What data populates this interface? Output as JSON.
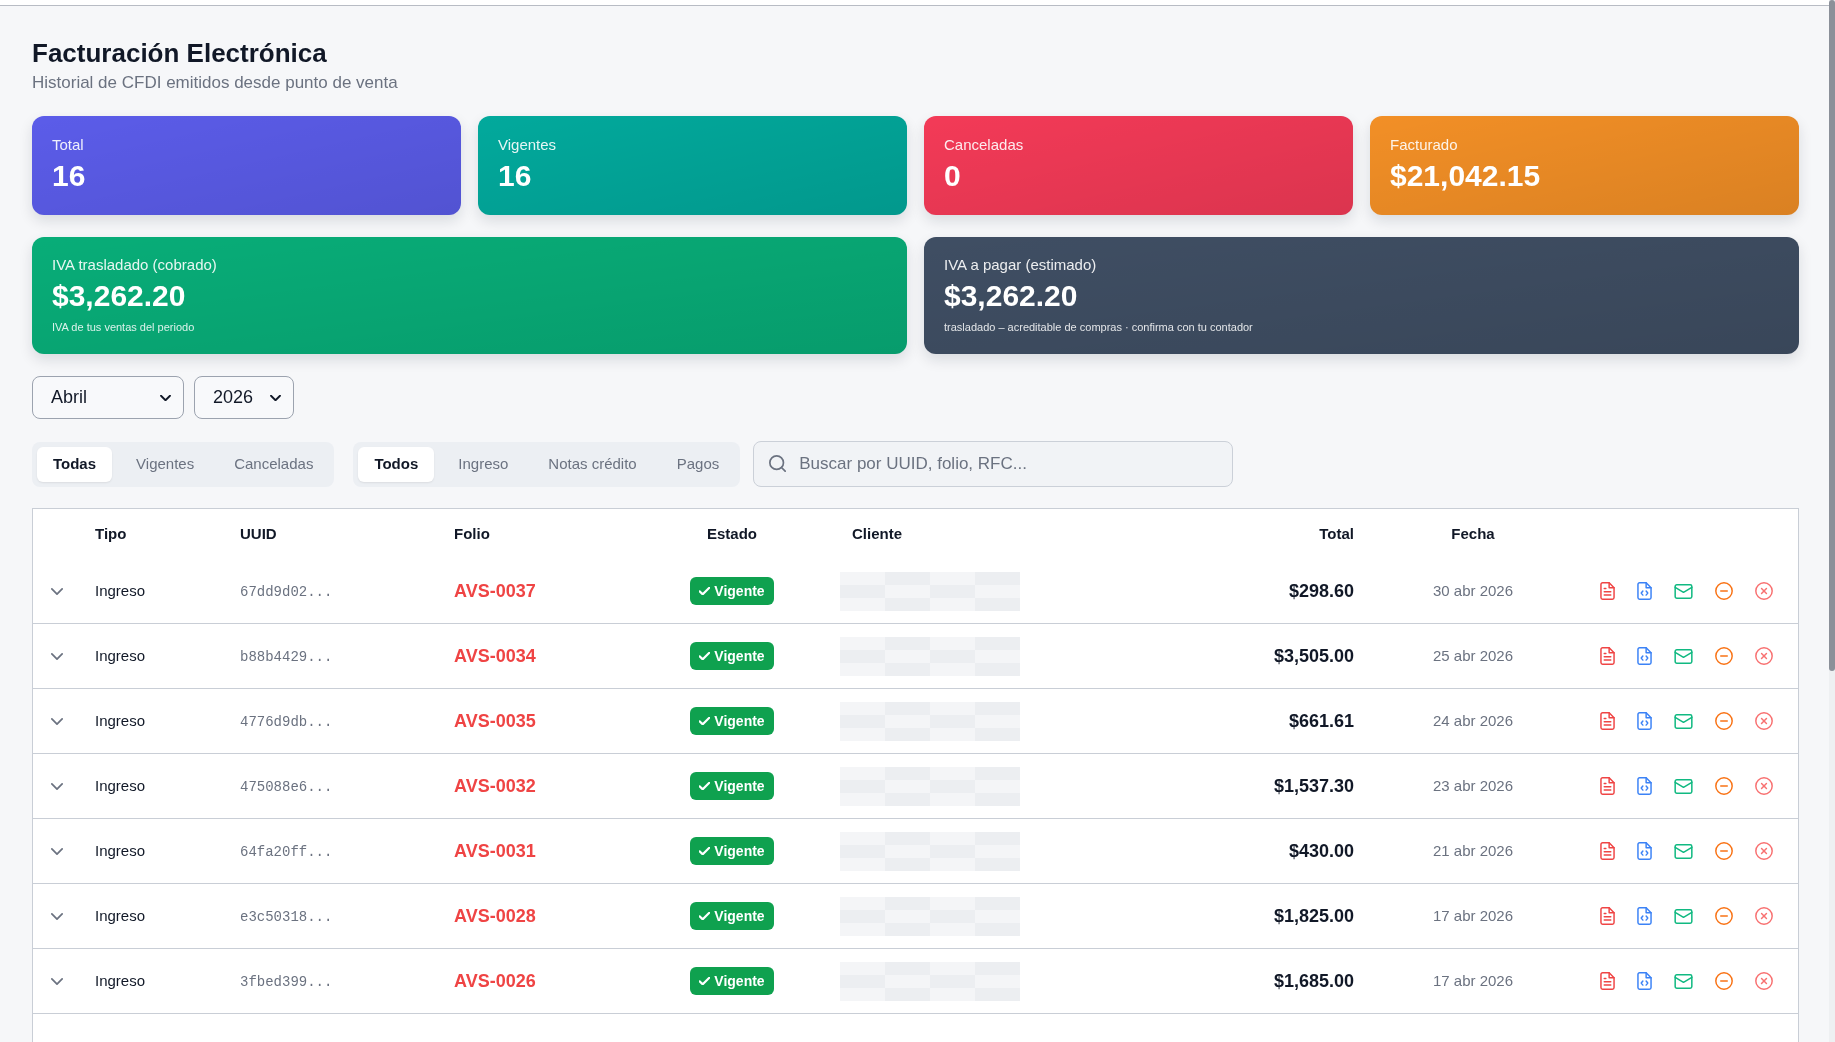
{
  "header": {
    "title": "Facturación Electrónica",
    "subtitle": "Historial de CFDI emitidos desde punto de venta"
  },
  "stats": [
    {
      "label": "Total",
      "value": "16",
      "color": "#5b5ce9"
    },
    {
      "label": "Vigentes",
      "value": "16",
      "color": "#02a99c"
    },
    {
      "label": "Canceladas",
      "value": "0",
      "color": "#f33a57"
    },
    {
      "label": "Facturado",
      "value": "$21,042.15",
      "color": "#f28f26"
    }
  ],
  "tax_cards": [
    {
      "label": "IVA trasladado (cobrado)",
      "value": "$3,262.20",
      "note": "IVA de tus ventas del periodo",
      "color": "#08ad78"
    },
    {
      "label": "IVA a pagar (estimado)",
      "value": "$3,262.20",
      "note": "trasladado – acreditable de compras · confirma con tu contador",
      "color": "#3f4e63"
    }
  ],
  "period_selects": [
    {
      "value": "Abril"
    },
    {
      "value": "2026"
    }
  ],
  "status_tabs": [
    {
      "label": "Todas",
      "selected": true
    },
    {
      "label": "Vigentes",
      "selected": false
    },
    {
      "label": "Canceladas",
      "selected": false
    }
  ],
  "type_tabs": [
    {
      "label": "Todos",
      "selected": true
    },
    {
      "label": "Ingreso",
      "selected": false
    },
    {
      "label": "Notas crédito",
      "selected": false
    },
    {
      "label": "Pagos",
      "selected": false
    }
  ],
  "search": {
    "placeholder": "Buscar por UUID, folio, RFC..."
  },
  "table": {
    "columns": [
      "Tipo",
      "UUID",
      "Folio",
      "Estado",
      "Cliente",
      "Total",
      "Fecha"
    ],
    "rows": [
      {
        "expanded": false,
        "type": "Ingreso",
        "uuid": "67dd9d02...",
        "folio": "AVS-0037",
        "status": {
          "label": "Vigente",
          "kind": "vigente"
        },
        "total": "$298.60",
        "date": "30 abr 2026"
      },
      {
        "expanded": false,
        "type": "Ingreso",
        "uuid": "b88b4429...",
        "folio": "AVS-0034",
        "status": {
          "label": "Vigente",
          "kind": "vigente"
        },
        "total": "$3,505.00",
        "date": "25 abr 2026"
      },
      {
        "expanded": false,
        "type": "Ingreso",
        "uuid": "4776d9db...",
        "folio": "AVS-0035",
        "status": {
          "label": "Vigente",
          "kind": "vigente"
        },
        "total": "$661.61",
        "date": "24 abr 2026"
      },
      {
        "expanded": false,
        "type": "Ingreso",
        "uuid": "475088e6...",
        "folio": "AVS-0032",
        "status": {
          "label": "Vigente",
          "kind": "vigente"
        },
        "total": "$1,537.30",
        "date": "23 abr 2026"
      },
      {
        "expanded": false,
        "type": "Ingreso",
        "uuid": "64fa20ff...",
        "folio": "AVS-0031",
        "status": {
          "label": "Vigente",
          "kind": "vigente"
        },
        "total": "$430.00",
        "date": "21 abr 2026"
      },
      {
        "expanded": false,
        "type": "Ingreso",
        "uuid": "e3c50318...",
        "folio": "AVS-0028",
        "status": {
          "label": "Vigente",
          "kind": "vigente"
        },
        "total": "$1,825.00",
        "date": "17 abr 2026"
      },
      {
        "expanded": false,
        "type": "Ingreso",
        "uuid": "3fbed399...",
        "folio": "AVS-0026",
        "status": {
          "label": "Vigente",
          "kind": "vigente"
        },
        "total": "$1,685.00",
        "date": "17 abr 2026"
      }
    ]
  }
}
